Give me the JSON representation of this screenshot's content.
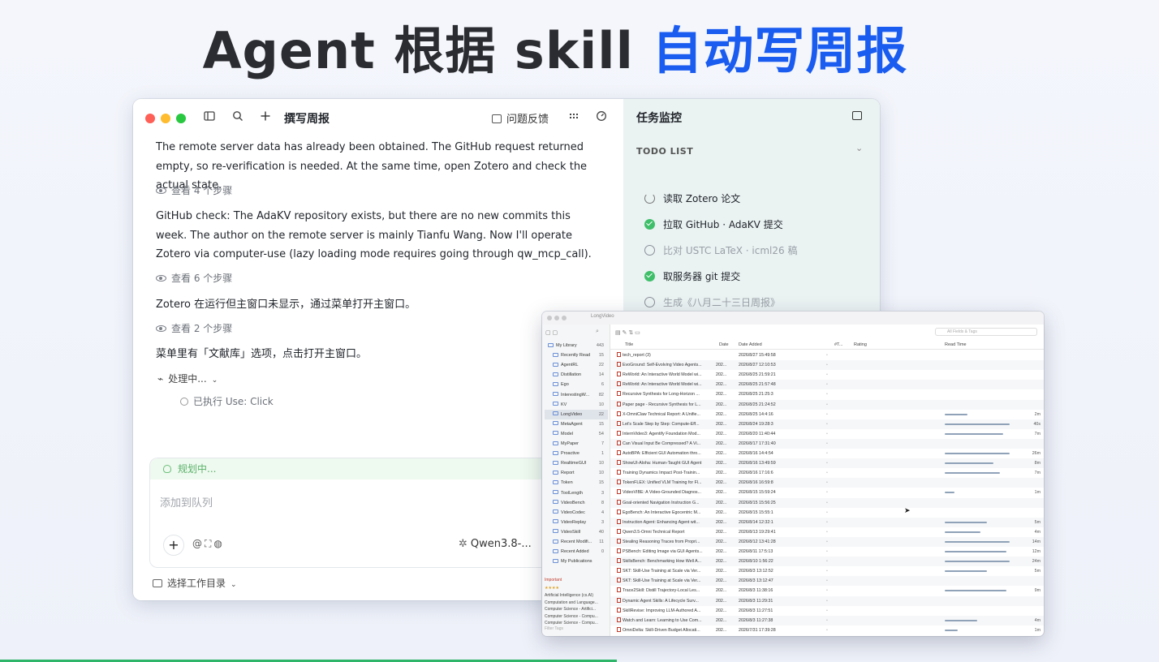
{
  "headline": {
    "prefix": "Agent 根据 skill ",
    "highlight": "自动写周报",
    "highlight_color": "#1a5cf0"
  },
  "app": {
    "toolbar": {
      "title": "撰写周报",
      "feedback_label": "问题反馈",
      "icons": [
        "sidebar-icon",
        "search-icon",
        "plus-icon",
        "grid-icon",
        "gauge-icon"
      ]
    },
    "messages": [
      {
        "text": "The remote server data has already been obtained. The GitHub request returned empty, so re-verification is needed. At the same time, open Zotero and check the actual state.",
        "steps": "查看 4 个步骤"
      },
      {
        "text": "GitHub check: The AdaKV repository exists, but there are no new commits this week. The author on the remote server is mainly Tianfu Wang. Now I'll operate Zotero via computer-use (lazy loading mode requires going through qw_mcp_call).",
        "steps": "查看 6 个步骤"
      },
      {
        "text": "Zotero 在运行但主窗口未显示，通过菜单打开主窗口。",
        "steps": "查看 2 个步骤"
      },
      {
        "text": "菜单里有「文献库」选项，点击打开主窗口。"
      }
    ],
    "processing_label": "处理中...",
    "executed_label": "已执行 Use: Click",
    "composer": {
      "status": "规划中...",
      "placeholder": "添加到队列",
      "model": "Qwen3.8-..."
    },
    "workdir_label": "选择工作目录",
    "tasks": {
      "title": "任务监控",
      "todo_header": "TODO LIST",
      "items": [
        {
          "label": "读取 Zotero 论文",
          "status": "running"
        },
        {
          "label": "拉取 GitHub · AdaKV 提交",
          "status": "done"
        },
        {
          "label": "比对 USTC LaTeX · icml26 稿",
          "status": "pending"
        },
        {
          "label": "取服务器 git 提交",
          "status": "done"
        },
        {
          "label": "生成《八月二十三日周报》",
          "status": "pending"
        }
      ]
    }
  },
  "zotero": {
    "window_title": "LongVideo",
    "search_placeholder": "All Fields & Tags",
    "columns": [
      "Title",
      "Date",
      "Date Added",
      "#T...",
      "Rating",
      "Read Time"
    ],
    "collections": [
      {
        "name": "My Library",
        "count": "443"
      },
      {
        "name": "Recently Read",
        "count": "15"
      },
      {
        "name": "AgentRL",
        "count": "22"
      },
      {
        "name": "Distillation",
        "count": "14"
      },
      {
        "name": "Ego",
        "count": "6"
      },
      {
        "name": "InterestingW...",
        "count": "82"
      },
      {
        "name": "KV",
        "count": "10"
      },
      {
        "name": "LongVideo",
        "count": "22"
      },
      {
        "name": "MetaAgent",
        "count": "15"
      },
      {
        "name": "Model",
        "count": "54"
      },
      {
        "name": "MyPaper",
        "count": "7"
      },
      {
        "name": "Proactive",
        "count": "1"
      },
      {
        "name": "RealtimeGUI",
        "count": "10"
      },
      {
        "name": "Report",
        "count": "10"
      },
      {
        "name": "Token",
        "count": "15"
      },
      {
        "name": "ToolLength",
        "count": "3"
      },
      {
        "name": "VideoBench",
        "count": "8"
      },
      {
        "name": "VideoCodec",
        "count": "4"
      },
      {
        "name": "VideoReplay",
        "count": "3"
      },
      {
        "name": "VideoSkill",
        "count": "40"
      },
      {
        "name": "Recent Modifi...",
        "count": "11"
      },
      {
        "name": "Recent Added",
        "count": "0"
      },
      {
        "name": "My Publications",
        "count": ""
      }
    ],
    "tags_header": "Important",
    "tags": [
      "Artificial Intelligence (cs.AI)",
      "Computation and Language...",
      "Computer Science - Artifici...",
      "Computer Science - Compu...",
      "Computer Science - Compu..."
    ],
    "filter_placeholder": "Filter Tags",
    "rows": [
      {
        "title": "tech_report (3)",
        "date": "",
        "added": "2026/8/27 15:49:58",
        "read": 0,
        "time": ""
      },
      {
        "title": "EvoGround: Self-Evolving Video Agents...",
        "date": "202...",
        "added": "2026/8/27 12:10:53",
        "read": 0,
        "time": ""
      },
      {
        "title": "ReWorld: An Interactive World Model wi...",
        "date": "202...",
        "added": "2026/8/25 21:59:21",
        "read": 0,
        "time": ""
      },
      {
        "title": "ReWorld: An Interactive World Model wi...",
        "date": "202...",
        "added": "2026/8/25 21:57:48",
        "read": 0,
        "time": ""
      },
      {
        "title": "Recursive Synthesis for Long-Horizon ...",
        "date": "202...",
        "added": "2026/8/25 21:25:3",
        "read": 0,
        "time": ""
      },
      {
        "title": "Paper page - Recursive Synthesis for L...",
        "date": "202...",
        "added": "2026/8/25 21:24:52",
        "read": 0,
        "time": ""
      },
      {
        "title": "X-OmniClaw Technical Report: A Unifie...",
        "date": "202...",
        "added": "2026/8/25 14:4:16",
        "read": 0.35,
        "time": "2m"
      },
      {
        "title": "Let's Scale Step by Step: Compute-Eff...",
        "date": "202...",
        "added": "2026/8/24 19:28:3",
        "read": 1,
        "time": "40s"
      },
      {
        "title": "InternVideo3: Agentify Foundation Mod...",
        "date": "202...",
        "added": "2026/8/20 11:40:44",
        "read": 0.9,
        "time": "7m"
      },
      {
        "title": "Can Visual Input Be Compressed? A Vi...",
        "date": "202...",
        "added": "2026/8/17 17:31:40",
        "read": 0,
        "time": ""
      },
      {
        "title": "AutoBPA: Efficient GUI Automation thro...",
        "date": "202...",
        "added": "2026/8/16 14:4:54",
        "read": 1,
        "time": "26m"
      },
      {
        "title": "ShowUI-Aloha: Human-Taught GUI Agent",
        "date": "202...",
        "added": "2026/8/16 13:49:59",
        "read": 0.75,
        "time": "8m"
      },
      {
        "title": "Training Dynamics Impact Post-Trainin...",
        "date": "202...",
        "added": "2026/8/16 17:16:6",
        "read": 0.85,
        "time": "7m"
      },
      {
        "title": "TokenFLEX: Unified VLM Training for Fl...",
        "date": "202...",
        "added": "2026/8/16 16:59:8",
        "read": 0,
        "time": ""
      },
      {
        "title": "VideoVIBE: A Video-Grounded Diagnos...",
        "date": "202...",
        "added": "2026/8/15 15:59:24",
        "read": 0.15,
        "time": "1m"
      },
      {
        "title": "Goal-oriented Navigation Instruction G...",
        "date": "202...",
        "added": "2026/8/15 15:56:25",
        "read": 0,
        "time": ""
      },
      {
        "title": "EgoBench: An Interactive Egocentric M...",
        "date": "202...",
        "added": "2026/8/15 15:55:1",
        "read": 0,
        "time": ""
      },
      {
        "title": "Instruction Agent: Enhancing Agent wit...",
        "date": "202...",
        "added": "2026/8/14 12:32:1",
        "read": 0.65,
        "time": "5m"
      },
      {
        "title": "Qwen3.5-Omni Technical Report",
        "date": "202...",
        "added": "2026/8/13 19:29:41",
        "read": 0.55,
        "time": "4m"
      },
      {
        "title": "Stealing Reasoning Traces from Propri...",
        "date": "202...",
        "added": "2026/8/12 13:41:28",
        "read": 1,
        "time": "14m"
      },
      {
        "title": "PSBench: Editing Image via GUI Agents...",
        "date": "202...",
        "added": "2026/8/11 17:5:13",
        "read": 0.95,
        "time": "12m"
      },
      {
        "title": "SkillsBench: Benchmarking How Well A...",
        "date": "202...",
        "added": "2026/8/10 1:56:22",
        "read": 1,
        "time": "24m"
      },
      {
        "title": "SKT: Skill-Use Training at Scale via Ver...",
        "date": "202...",
        "added": "2026/8/3 13:12:52",
        "read": 0.65,
        "time": "5m"
      },
      {
        "title": "SKT: Skill-Use Training at Scale via Ver...",
        "date": "202...",
        "added": "2026/8/3 13:12:47",
        "read": 0,
        "time": ""
      },
      {
        "title": "Trace2Skill: Distill Trajectory-Local Les...",
        "date": "202...",
        "added": "2026/8/3 11:38:16",
        "read": 0.95,
        "time": "9m"
      },
      {
        "title": "Dynamic Agent Skills: A Lifecycle Surv...",
        "date": "202...",
        "added": "2026/8/3 11:29:31",
        "read": 0,
        "time": ""
      },
      {
        "title": "SkillRevise: Improving LLM-Authored A...",
        "date": "202...",
        "added": "2026/8/3 11:27:51",
        "read": 0,
        "time": ""
      },
      {
        "title": "Watch and Learn: Learning to Use Com...",
        "date": "202...",
        "added": "2026/8/3 11:27:38",
        "read": 0.5,
        "time": "4m"
      },
      {
        "title": "OmniDelta: Skill-Driven Budget Allocati...",
        "date": "202...",
        "added": "2026/7/31 17:39:28",
        "read": 0.2,
        "time": "1m"
      }
    ]
  }
}
